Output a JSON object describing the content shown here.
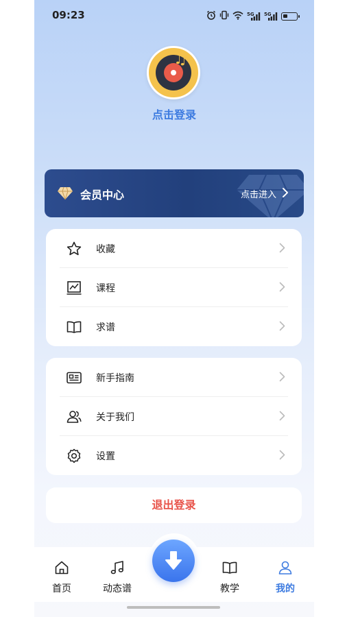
{
  "status_bar": {
    "time": "09:23",
    "icons": [
      "alarm-icon",
      "vibrate-icon",
      "wifi-icon",
      "signal-5g-icon",
      "signal-5g-icon",
      "battery-icon"
    ],
    "signal_labels": [
      "5G",
      "5G"
    ]
  },
  "profile": {
    "avatar_icon": "music-disc-icon",
    "login_label": "点击登录"
  },
  "vip": {
    "label": "会员中心",
    "enter_label": "点击进入",
    "icon": "diamond-icon"
  },
  "menu_group_1": [
    {
      "label": "收藏",
      "icon": "star-icon"
    },
    {
      "label": "课程",
      "icon": "chart-board-icon"
    },
    {
      "label": "求谱",
      "icon": "book-icon"
    }
  ],
  "menu_group_2": [
    {
      "label": "新手指南",
      "icon": "id-card-icon"
    },
    {
      "label": "关于我们",
      "icon": "users-icon"
    },
    {
      "label": "设置",
      "icon": "gear-icon"
    }
  ],
  "logout_label": "退出登录",
  "tabs": [
    {
      "label": "首页",
      "icon": "home-icon",
      "active": false
    },
    {
      "label": "动态谱",
      "icon": "music-note-icon",
      "active": false
    },
    {
      "label": "",
      "icon": "download-icon",
      "active": false
    },
    {
      "label": "教学",
      "icon": "book-open-icon",
      "active": false
    },
    {
      "label": "我的",
      "icon": "user-icon",
      "active": true
    }
  ],
  "colors": {
    "accent": "#3d7be0",
    "logout": "#e8534a",
    "vip_bg": "#22407c",
    "avatar_bg": "#f4c24c"
  }
}
